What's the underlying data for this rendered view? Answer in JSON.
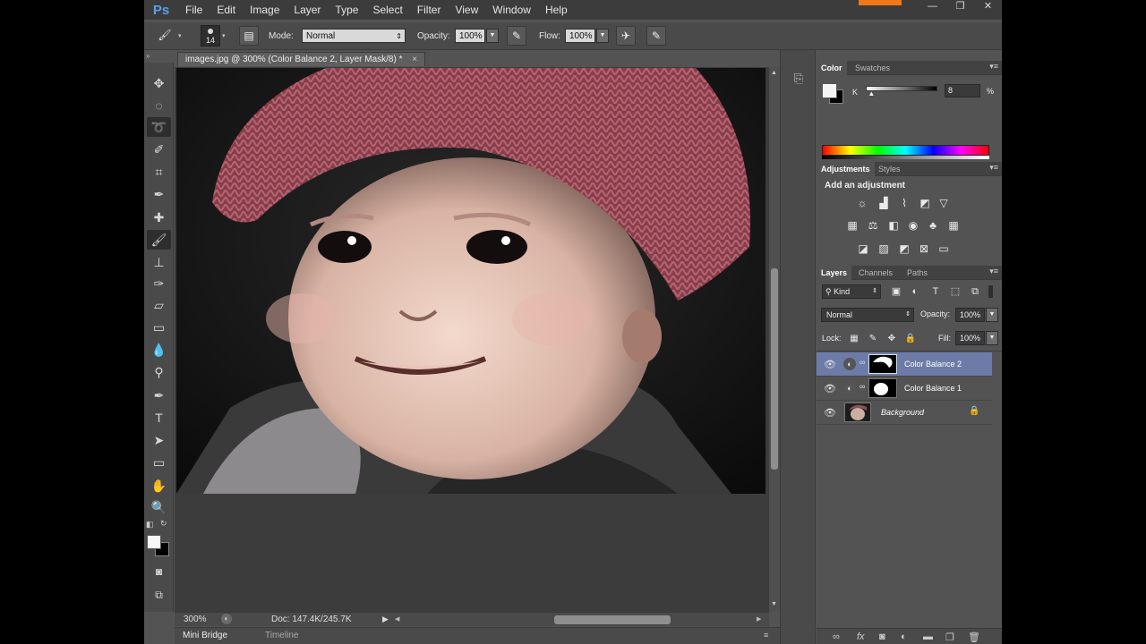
{
  "app": {
    "logo": "Ps"
  },
  "menu": [
    "File",
    "Edit",
    "Image",
    "Layer",
    "Type",
    "Select",
    "Filter",
    "View",
    "Window",
    "Help"
  ],
  "window_controls": {
    "minimize": "—",
    "restore": "❐",
    "close": "✕"
  },
  "options_bar": {
    "brush_size": "14",
    "mode_label": "Mode:",
    "mode_value": "Normal",
    "opacity_label": "Opacity:",
    "opacity_value": "100%",
    "flow_label": "Flow:",
    "flow_value": "100%"
  },
  "document": {
    "tab_title": "images.jpg @ 300% (Color Balance 2, Layer Mask/8) *",
    "close": "×"
  },
  "status_bar": {
    "zoom": "300%",
    "doc_info": "Doc: 147.4K/245.7K"
  },
  "bottom_tabs": [
    "Mini Bridge",
    "Timeline"
  ],
  "color_panel": {
    "tabs": [
      "Color",
      "Swatches"
    ],
    "channel": "K",
    "value": "8",
    "unit": "%",
    "slider_level": 0.08
  },
  "adjustments_panel": {
    "tabs": [
      "Adjustments",
      "Styles"
    ],
    "heading": "Add an adjustment"
  },
  "layers_panel": {
    "tabs": [
      "Layers",
      "Channels",
      "Paths"
    ],
    "filter_kind": "Kind",
    "blend_mode": "Normal",
    "opacity_label": "Opacity:",
    "opacity_value": "100%",
    "lock_label": "Lock:",
    "fill_label": "Fill:",
    "fill_value": "100%",
    "layers": [
      {
        "name": "Color Balance 2",
        "selected": true
      },
      {
        "name": "Color Balance 1",
        "selected": false
      },
      {
        "name": "Background",
        "selected": false
      }
    ]
  },
  "colors": {
    "accent_orange": "#f07818",
    "ps_blue": "#5aa0e6",
    "selected_layer": "#6c7ba8"
  }
}
